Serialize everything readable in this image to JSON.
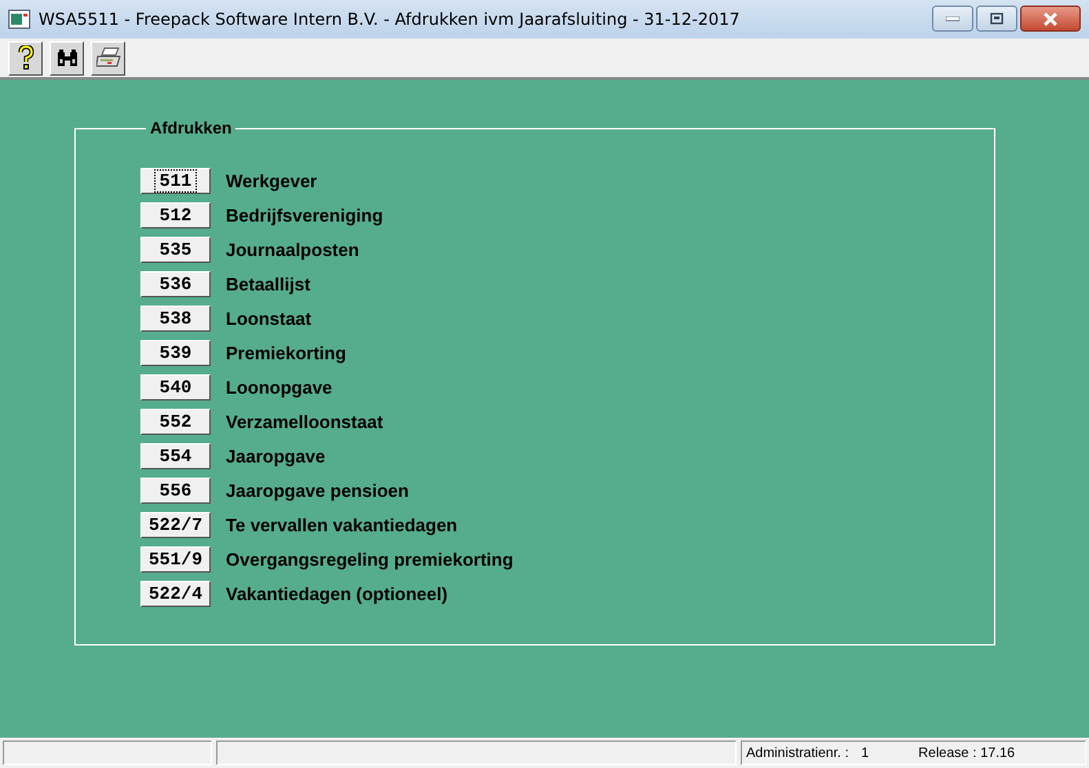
{
  "window": {
    "title": "WSA5511  -  Freepack Software Intern B.V.  -  Afdrukken ivm Jaarafsluiting  -  31-12-2017"
  },
  "group": {
    "title": "Afdrukken",
    "items": [
      {
        "code": "511",
        "label": "Werkgever",
        "focused": true
      },
      {
        "code": "512",
        "label": "Bedrijfsvereniging",
        "focused": false
      },
      {
        "code": "535",
        "label": "Journaalposten",
        "focused": false
      },
      {
        "code": "536",
        "label": "Betaallijst",
        "focused": false
      },
      {
        "code": "538",
        "label": "Loonstaat",
        "focused": false
      },
      {
        "code": "539",
        "label": "Premiekorting",
        "focused": false
      },
      {
        "code": "540",
        "label": "Loonopgave",
        "focused": false
      },
      {
        "code": "552",
        "label": "Verzamelloonstaat",
        "focused": false
      },
      {
        "code": "554",
        "label": "Jaaropgave",
        "focused": false
      },
      {
        "code": "556",
        "label": "Jaaropgave pensioen",
        "focused": false
      },
      {
        "code": "522/7",
        "label": "Te vervallen vakantiedagen",
        "focused": false
      },
      {
        "code": "551/9",
        "label": "Overgangsregeling premiekorting",
        "focused": false
      },
      {
        "code": "522/4",
        "label": "Vakantiedagen (optioneel)",
        "focused": false
      }
    ]
  },
  "status_bar": {
    "admin_label": "Administratienr. :",
    "admin_value": "1",
    "release": "Release : 17.16"
  }
}
